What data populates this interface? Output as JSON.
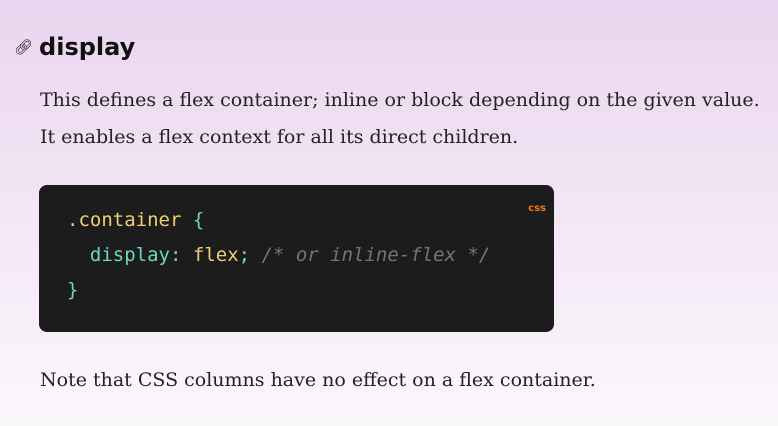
{
  "heading": {
    "icon": "link-icon",
    "text": "display"
  },
  "description": "This defines a flex container; inline or block depending on the given value. It enables a flex context for all its direct children.",
  "code": {
    "language": "css",
    "selector": ".container",
    "open_brace": "{",
    "property": "display",
    "colon": ":",
    "value": "flex",
    "semicolon": ";",
    "comment": "/* or inline-flex */",
    "close_brace": "}"
  },
  "note": "Note that CSS columns have no effect on a flex container.",
  "colors": {
    "code_bg": "#1c1c1c",
    "selector": "#f0cf74",
    "property": "#6fd4c5",
    "comment": "#6a7a76",
    "language_label": "#f07a1a"
  }
}
